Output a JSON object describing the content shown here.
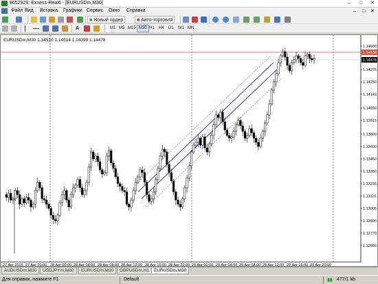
{
  "window": {
    "title": "8652929: Exness-Real6 - [EURUSDm,M30]"
  },
  "menu": {
    "items": [
      "Файл",
      "Вид",
      "Вставка",
      "Графики",
      "Сервис",
      "Окно",
      "Справка"
    ]
  },
  "toolbar": {
    "new_order_label": "Новый ордер",
    "autotrade_label": "Авто-торговля",
    "timeframes": [
      "M1",
      "M5",
      "M15",
      "M30",
      "H1",
      "H4",
      "D1",
      "W1",
      "MN"
    ],
    "active_timeframe": "M30",
    "text_tool_label": "A"
  },
  "chart": {
    "header": "EURUSDm,M30  1.14510 1.14514 1.14399 1.14478",
    "ask_price_label": "1.14538",
    "bid_price_label": "1.14478",
    "x_tick_labels": [
      "27 Apr 2016",
      "27 Apr 20:00",
      "28 Apr 00:00",
      "28 Apr 04:00",
      "28 Apr 08:00",
      "28 Apr 12:00",
      "28 Apr 16:00",
      "28 Apr 20:00",
      "29 Apr 00:00",
      "29 Apr 04:00",
      "29 Apr 08:00",
      "29 Apr 12:00",
      "29 Apr 16:00",
      "29 Apr 20:00"
    ],
    "y_tick_labels": [
      "1.14600",
      "1.14375",
      "1.14250",
      "1.14142",
      "1.14030",
      "1.13915",
      "1.13800",
      "1.13690",
      "1.13460",
      "1.13350",
      "1.13235",
      "1.13115",
      "1.13005",
      "1.12890",
      "1.12770",
      "1.12655"
    ],
    "colors": {
      "up": "#ffffff",
      "down": "#000000",
      "ask_line": "#e05040",
      "channel": "#0000cc"
    }
  },
  "tabs": [
    {
      "label": "AUDUSDm,M30",
      "active": false
    },
    {
      "label": "USDJPYm,M30",
      "active": false
    },
    {
      "label": "EURUSDm,M30",
      "active": false
    },
    {
      "label": "GBPUSDm,H1",
      "active": false
    },
    {
      "label": "EURUSDm,M30",
      "active": true
    }
  ],
  "status": {
    "help_text": "Для справки, нажмите F1",
    "profile": "Default",
    "traffic": "477/1 kb"
  }
}
